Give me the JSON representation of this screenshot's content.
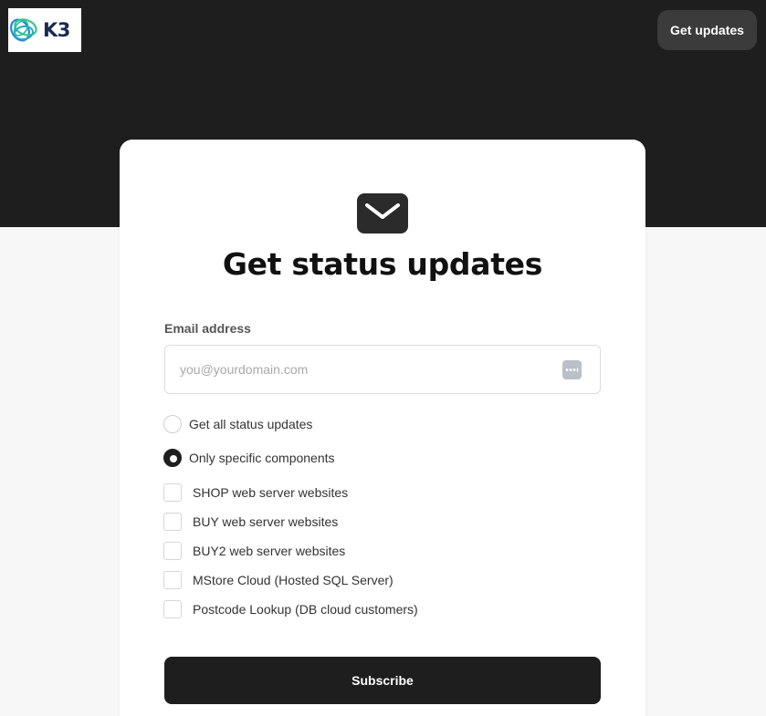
{
  "header": {
    "logo_text": "K3",
    "get_updates_label": "Get updates",
    "brand_colors": {
      "ring_blue": "#1e88e5",
      "ring_green": "#34c98a",
      "text": "#1b2a52"
    }
  },
  "card": {
    "icon": "mail-icon",
    "title": "Get status updates",
    "email_label": "Email address",
    "email_placeholder": "you@yourdomain.com",
    "email_value": "",
    "password_manager_icon": "password-manager-icon",
    "radio_options": [
      {
        "label": "Get all status updates",
        "checked": false
      },
      {
        "label": "Only specific components",
        "checked": true
      }
    ],
    "components": [
      {
        "label": "SHOP web server websites",
        "checked": false
      },
      {
        "label": "BUY web server websites",
        "checked": false
      },
      {
        "label": "BUY2 web server websites",
        "checked": false
      },
      {
        "label": "MStore Cloud (Hosted SQL Server)",
        "checked": false
      },
      {
        "label": "Postcode Lookup (DB cloud customers)",
        "checked": false
      }
    ],
    "subscribe_label": "Subscribe"
  },
  "colors": {
    "header_bg": "#1e1e1e",
    "page_bg": "#f7f7f7",
    "button_bg": "#1e1e1e"
  }
}
